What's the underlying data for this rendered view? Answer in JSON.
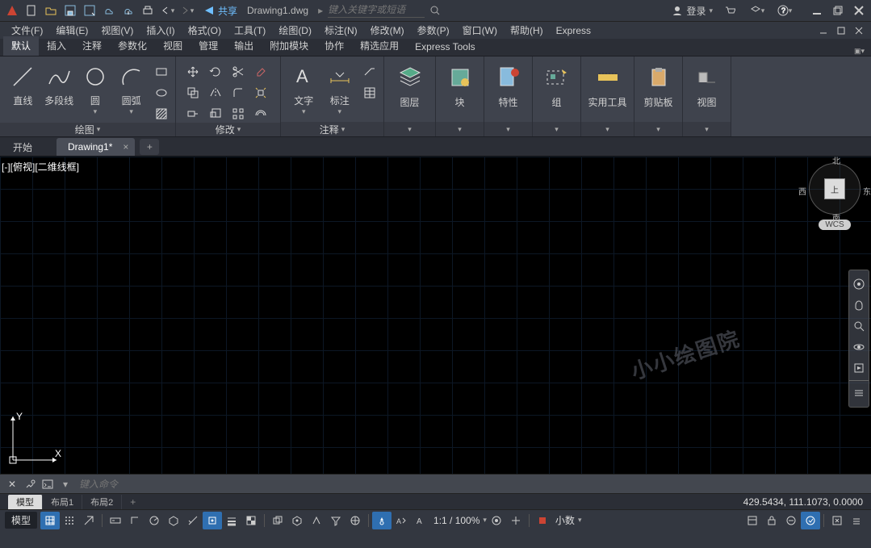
{
  "title": {
    "share": "共享",
    "filename": "Drawing1.dwg",
    "search_placeholder": "键入关键字或短语",
    "login": "登录"
  },
  "menubar": [
    "文件(F)",
    "编辑(E)",
    "视图(V)",
    "插入(I)",
    "格式(O)",
    "工具(T)",
    "绘图(D)",
    "标注(N)",
    "修改(M)",
    "参数(P)",
    "窗口(W)",
    "帮助(H)",
    "Express"
  ],
  "ribbon_tabs": [
    "默认",
    "插入",
    "注释",
    "参数化",
    "视图",
    "管理",
    "输出",
    "附加模块",
    "协作",
    "精选应用",
    "Express Tools"
  ],
  "ribbon_tabs_active": 0,
  "panels": {
    "draw": {
      "title": "绘图",
      "big": [
        {
          "label": "直线",
          "name": "line"
        },
        {
          "label": "多段线",
          "name": "polyline"
        },
        {
          "label": "圆",
          "name": "circle"
        },
        {
          "label": "圆弧",
          "name": "arc"
        }
      ]
    },
    "modify": {
      "title": "修改"
    },
    "annotation": {
      "title": "注释",
      "big": [
        {
          "label": "文字",
          "name": "text"
        },
        {
          "label": "标注",
          "name": "dimension"
        }
      ]
    },
    "layers": {
      "label": "图层"
    },
    "block": {
      "label": "块"
    },
    "properties": {
      "label": "特性"
    },
    "group": {
      "label": "组"
    },
    "utilities": {
      "label": "实用工具"
    },
    "clipboard": {
      "label": "剪贴板"
    },
    "view": {
      "label": "视图"
    }
  },
  "filetabs": [
    {
      "label": "开始",
      "active": false,
      "closable": false
    },
    {
      "label": "Drawing1*",
      "active": true,
      "closable": true
    }
  ],
  "viewport_label": "[-][俯视][二维线框]",
  "viewcube": {
    "top": "上",
    "n": "北",
    "s": "南",
    "e": "东",
    "w": "西",
    "wcs": "WCS"
  },
  "watermark": "小小绘图院",
  "ucs": {
    "x": "X",
    "y": "Y"
  },
  "commandline": {
    "placeholder": "键入命令"
  },
  "layout_tabs": [
    {
      "label": "模型",
      "active": true
    },
    {
      "label": "布局1",
      "active": false
    },
    {
      "label": "布局2",
      "active": false
    }
  ],
  "coords": "429.5434, 111.1073, 0.0000",
  "status": {
    "model": "模型",
    "scale": "1:1 / 100%",
    "units": "小数"
  }
}
